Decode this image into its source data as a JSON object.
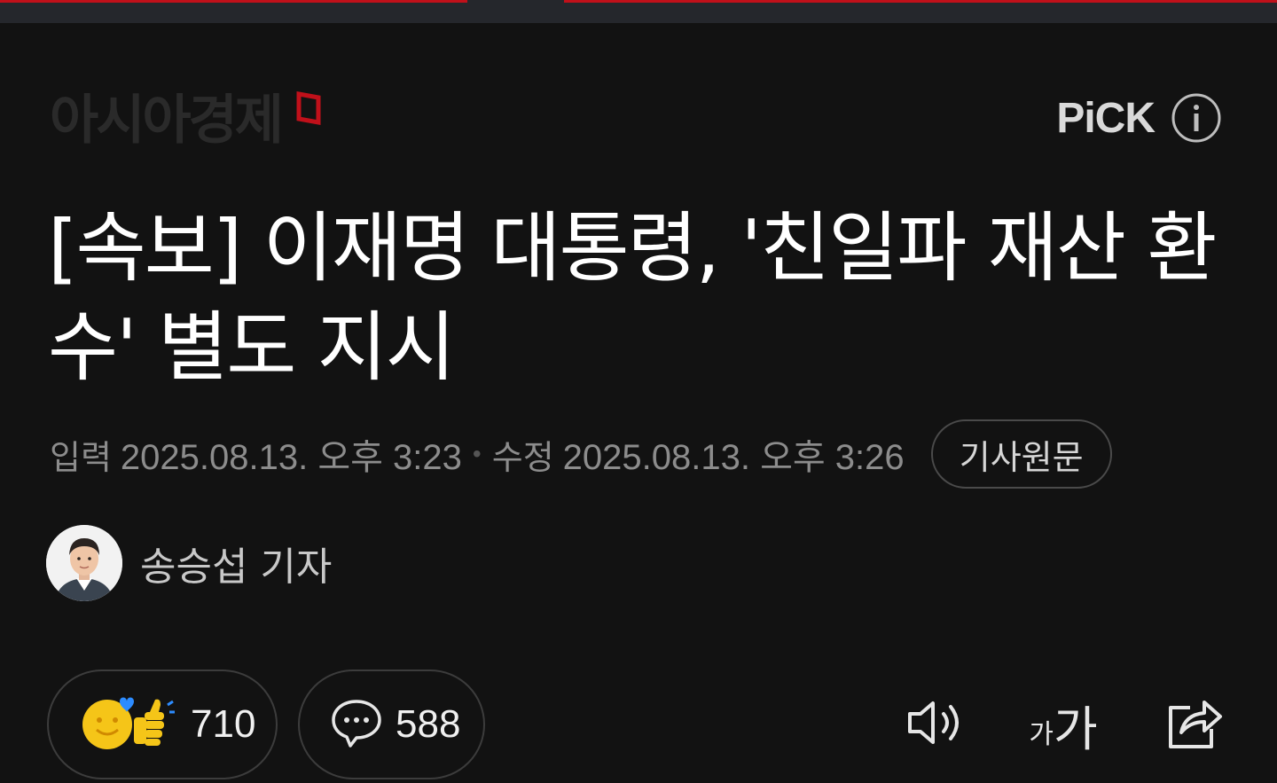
{
  "header": {
    "logo_text": "아시아경제",
    "pick_label": "PiCK"
  },
  "article": {
    "headline": "[속보] 이재명 대통령, '친일파 재산 환수' 별도 지시",
    "input_label": "입력",
    "input_time": "2025.08.13. 오후 3:23",
    "modified_label": "수정",
    "modified_time": "2025.08.13. 오후 3:26",
    "original_button": "기사원문",
    "author": "송승섭 기자"
  },
  "actions": {
    "reaction_count": "710",
    "comment_count": "588",
    "font_small": "가",
    "font_big": "가"
  },
  "colors": {
    "background": "#121212",
    "accent": "#c0101a",
    "reaction_yellow": "#f5c518",
    "heart_blue": "#2d8cff"
  }
}
